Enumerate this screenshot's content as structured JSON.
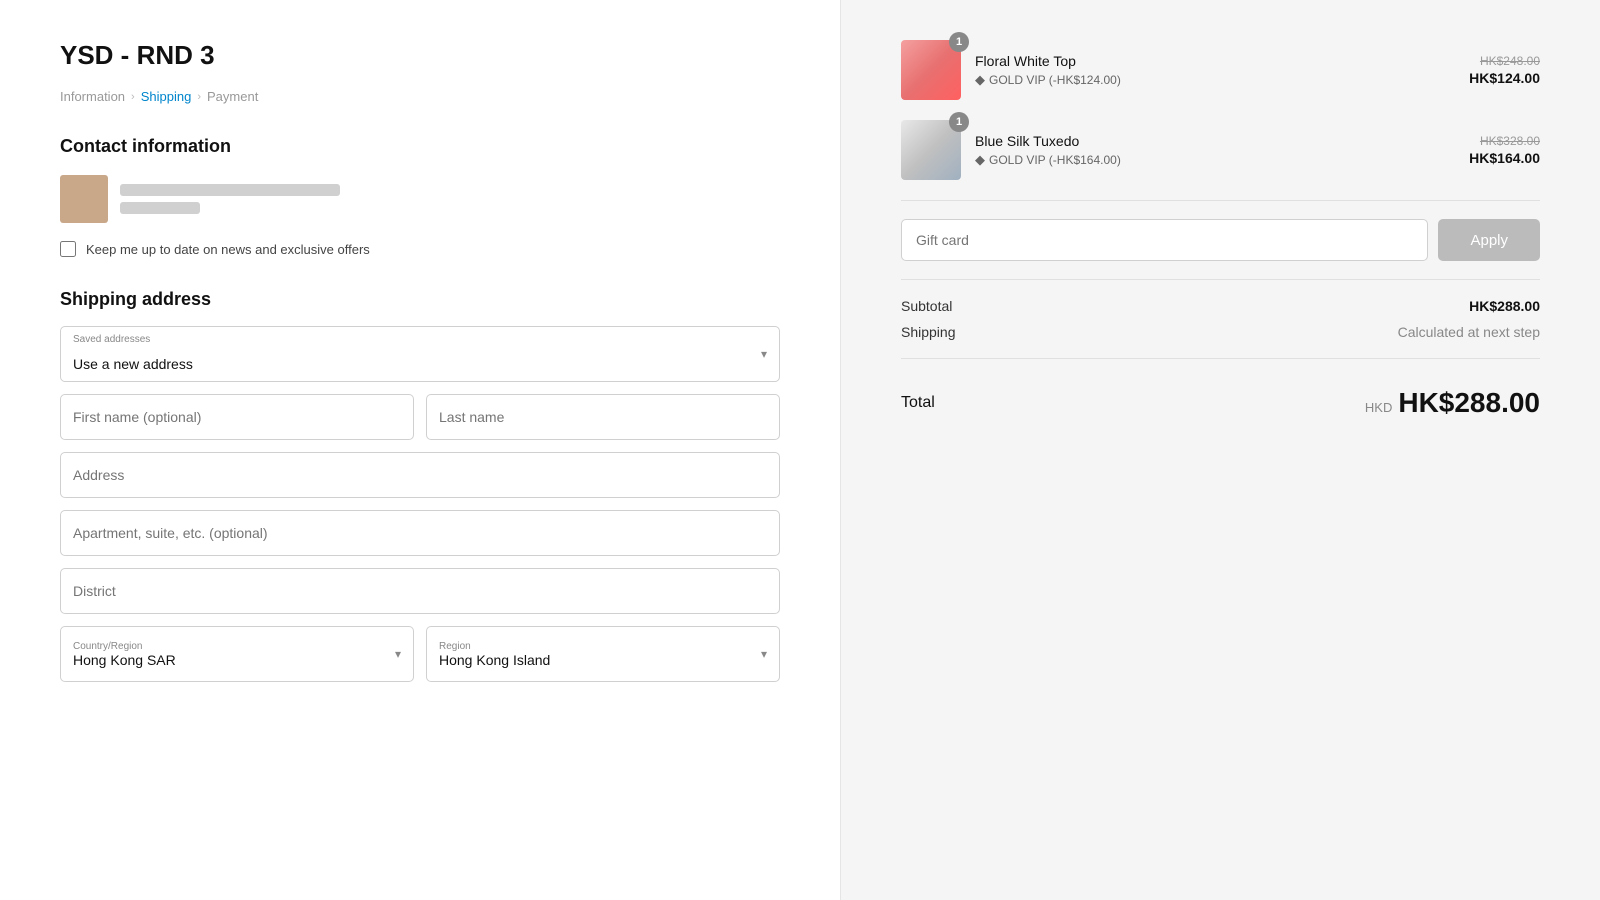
{
  "store": {
    "title": "YSD - RND 3"
  },
  "breadcrumb": {
    "items": [
      {
        "label": "Information",
        "active": false
      },
      {
        "label": "Shipping",
        "active": true
      },
      {
        "label": "Payment",
        "active": false
      }
    ]
  },
  "contact": {
    "section_title": "Contact information",
    "newsletter_label": "Keep me up to date on news and exclusive offers"
  },
  "shipping": {
    "section_title": "Shipping address",
    "saved_addresses_label": "Saved addresses",
    "use_new_address": "Use a new address",
    "first_name_placeholder": "First name (optional)",
    "last_name_placeholder": "Last name",
    "address_placeholder": "Address",
    "apartment_placeholder": "Apartment, suite, etc. (optional)",
    "district_placeholder": "District",
    "country_label": "Country/Region",
    "country_value": "Hong Kong SAR",
    "region_label": "Region",
    "region_value": "Hong Kong Island"
  },
  "order": {
    "items": [
      {
        "name": "Floral White Top",
        "vip_label": "GOLD VIP (-HK$124.00)",
        "quantity": 1,
        "price_original": "HK$248.00",
        "price_current": "HK$124.00"
      },
      {
        "name": "Blue Silk Tuxedo",
        "vip_label": "GOLD VIP (-HK$164.00)",
        "quantity": 1,
        "price_original": "HK$328.00",
        "price_current": "HK$164.00"
      }
    ],
    "gift_card_placeholder": "Gift card",
    "apply_label": "Apply",
    "subtotal_label": "Subtotal",
    "subtotal_value": "HK$288.00",
    "shipping_label": "Shipping",
    "shipping_value": "Calculated at next step",
    "total_label": "Total",
    "total_currency": "HKD",
    "total_amount": "HK$288.00"
  }
}
